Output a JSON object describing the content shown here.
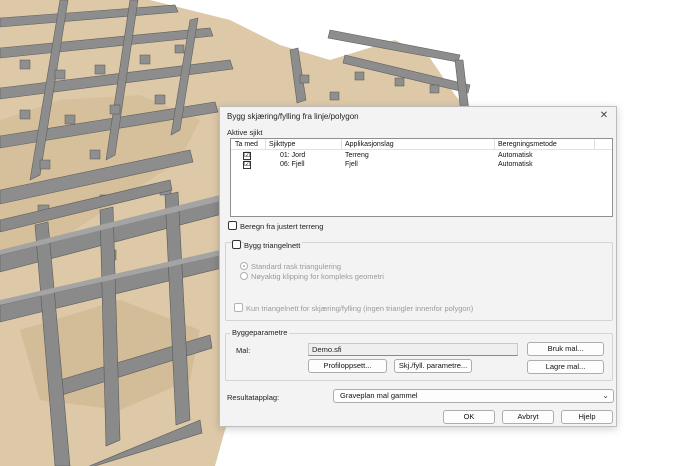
{
  "dialog": {
    "title": "Bygg skjæring/fylling fra linje/polygon",
    "close_icon": "close-icon"
  },
  "active_layers": {
    "group_label": "Aktive sjikt",
    "columns": [
      "Ta med",
      "Sjikttype",
      "Applikasjonslag",
      "Beregningsmetode"
    ],
    "rows": [
      {
        "checked": true,
        "type": "01: Jord",
        "layer": "Terreng",
        "method": "Automatisk"
      },
      {
        "checked": true,
        "type": "06: Fjell",
        "layer": "Fjell",
        "method": "Automatisk"
      }
    ],
    "checkmark": "☑"
  },
  "options": {
    "adjusted_terrain_label": "Beregn fra justert terreng",
    "build_triangle_label": "Bygg triangelnett",
    "radio_standard": "Standard rask triangulering",
    "radio_exact": "Nøyaktig klipping for kompleks geometri",
    "only_triangle_label": "Kun triangelnett for skjæring/fylling (ingen triangler innenfor polygon)"
  },
  "build_params": {
    "group_label": "Byggeparametre",
    "template_label": "Mal:",
    "template_value": "Demo.sfi",
    "use_template_btn": "Bruk mal...",
    "save_template_btn": "Lagre mal...",
    "profile_btn": "Profiloppsett...",
    "cutfill_btn": "Skj./fyll. parametre..."
  },
  "result": {
    "label": "Resultatapplag:",
    "value": "Graveplan mal gammel"
  },
  "footer": {
    "ok": "OK",
    "cancel": "Avbryt",
    "help": "Hjelp"
  },
  "colors": {
    "terrain": "#ddc9a8",
    "terrain_dark": "#c7ae84",
    "wall": "#8d8d8d",
    "wall_dark": "#5f5f5f"
  }
}
